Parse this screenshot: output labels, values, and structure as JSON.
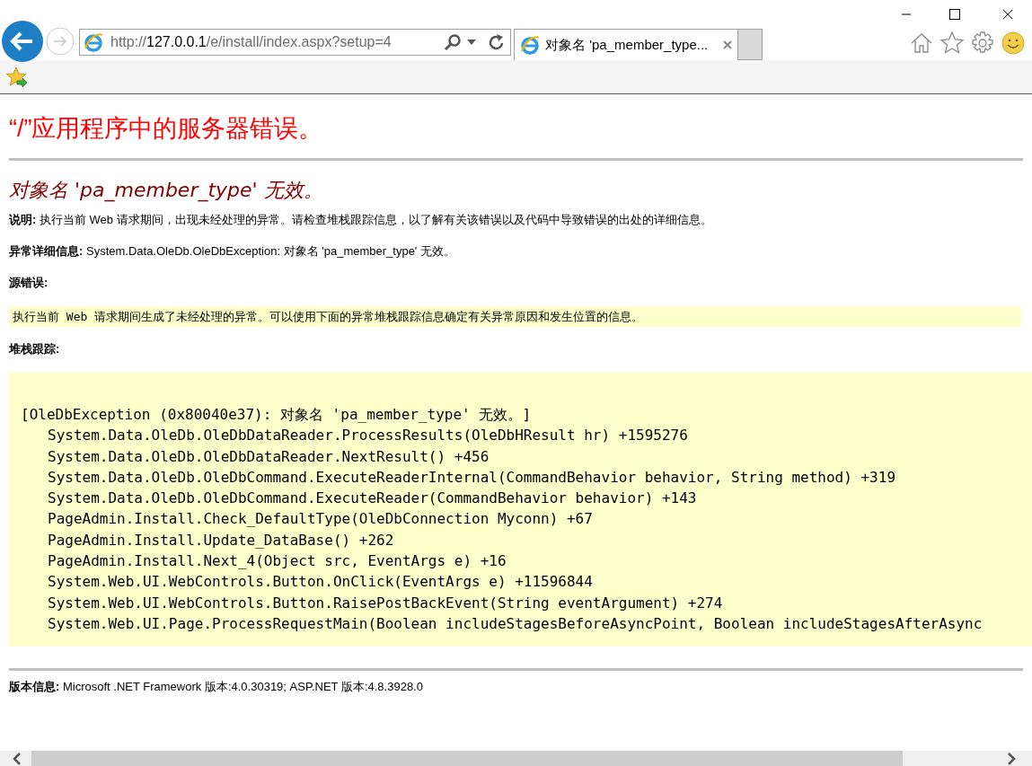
{
  "browser": {
    "address": {
      "scheme": "http://",
      "host": "127.0.0.1",
      "path": "/e/install/index.aspx?setup=4"
    },
    "tabs": [
      {
        "kind": "page",
        "label": "对象名 'pa_member_type...",
        "selected": true
      },
      {
        "kind": "new_tab",
        "selected": false
      }
    ]
  },
  "page": {
    "title": "“/”应用程序中的服务器错误。",
    "subtitle": "对象名 'pa_member_type' 无效。",
    "description": {
      "label": "说明:",
      "text": "执行当前 Web 请求期间，出现未经处理的异常。请检查堆栈跟踪信息，以了解有关该错误以及代码中导致错误的出处的详细信息。"
    },
    "exception_details": {
      "label": "异常详细信息:",
      "text": "System.Data.OleDb.OleDbException: 对象名 'pa_member_type' 无效。"
    },
    "source_error": {
      "label": "源错误:",
      "text": "执行当前 Web 请求期间生成了未经处理的异常。可以使用下面的异常堆栈跟踪信息确定有关异常原因和发生位置的信息。"
    },
    "stack_trace": {
      "label": "堆栈跟踪:",
      "lines": [
        {
          "kind": "exception",
          "text": "[OleDbException (0x80040e37): 对象名 'pa_member_type' 无效。]"
        },
        {
          "kind": "frame",
          "text": "System.Data.OleDb.OleDbDataReader.ProcessResults(OleDbHResult hr) +1595276"
        },
        {
          "kind": "frame",
          "text": "System.Data.OleDb.OleDbDataReader.NextResult() +456"
        },
        {
          "kind": "frame",
          "text": "System.Data.OleDb.OleDbCommand.ExecuteReaderInternal(CommandBehavior behavior, String method) +319"
        },
        {
          "kind": "frame",
          "text": "System.Data.OleDb.OleDbCommand.ExecuteReader(CommandBehavior behavior) +143"
        },
        {
          "kind": "frame",
          "text": "PageAdmin.Install.Check_DefaultType(OleDbConnection Myconn) +67"
        },
        {
          "kind": "frame",
          "text": "PageAdmin.Install.Update_DataBase() +262"
        },
        {
          "kind": "frame",
          "text": "PageAdmin.Install.Next_4(Object src, EventArgs e) +16"
        },
        {
          "kind": "frame",
          "text": "System.Web.UI.WebControls.Button.OnClick(EventArgs e) +11596844"
        },
        {
          "kind": "frame",
          "text": "System.Web.UI.WebControls.Button.RaisePostBackEvent(String eventArgument) +274"
        },
        {
          "kind": "frame",
          "text": "System.Web.UI.Page.ProcessRequestMain(Boolean includeStagesBeforeAsyncPoint, Boolean includeStagesAfterAsync"
        }
      ]
    },
    "version": {
      "label": "版本信息:",
      "text": "Microsoft .NET Framework 版本:4.0.30319; ASP.NET 版本:4.8.3928.0"
    }
  }
}
